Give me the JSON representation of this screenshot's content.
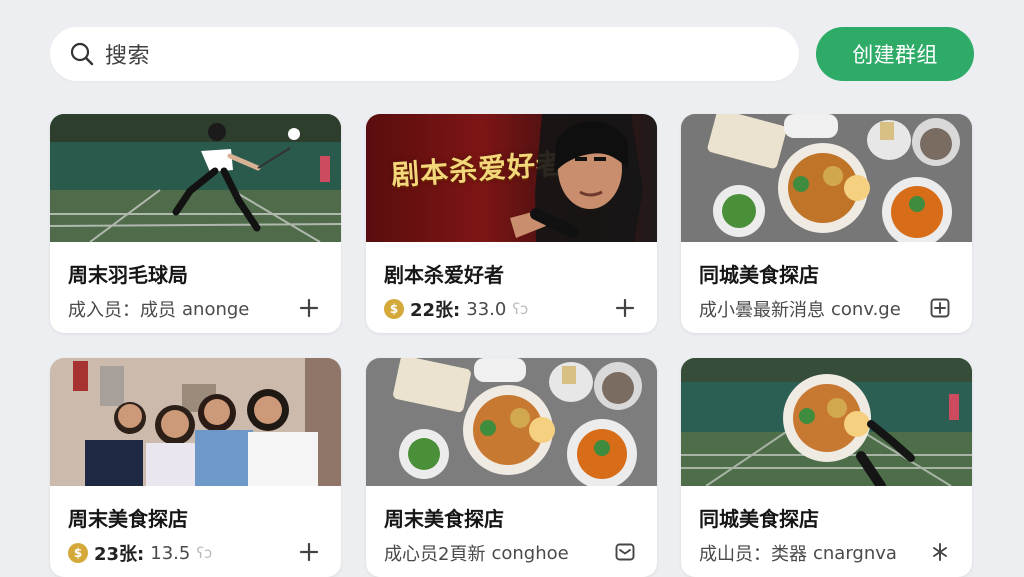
{
  "search": {
    "placeholder": "搜索"
  },
  "actions": {
    "create_group": "创建群组"
  },
  "cards": [
    {
      "title": "周末羽毛球局",
      "meta_prefix": "成入员：成员",
      "meta_suffix": "anonge",
      "icon": "plus-icon"
    },
    {
      "title": "剧本杀爱好者",
      "poster": "剧本杀爱好者",
      "meta_count": "22张:",
      "meta_value": "33.0",
      "meta_faint": "ʕɔ",
      "icon": "plus-icon"
    },
    {
      "title": "同城美食探店",
      "meta_prefix": "成小曇最新消息",
      "meta_suffix": "conv.ge",
      "icon": "square-plus-icon"
    },
    {
      "title": "周末美食探店",
      "meta_count": "23张:",
      "meta_value": "13.5",
      "meta_faint": "ʕɔ",
      "icon": "plus-icon"
    },
    {
      "title": "周末美食探店",
      "meta_prefix": "成心员2頁新",
      "meta_suffix": "conghoe",
      "icon": "message-icon"
    },
    {
      "title": "同城美食探店",
      "meta_prefix": "成山员：类器",
      "meta_suffix": "cnargnva",
      "icon": "split-icon"
    }
  ],
  "colors": {
    "background": "#eceef1",
    "accent": "#2fab68",
    "coin": "#d4a93a"
  }
}
